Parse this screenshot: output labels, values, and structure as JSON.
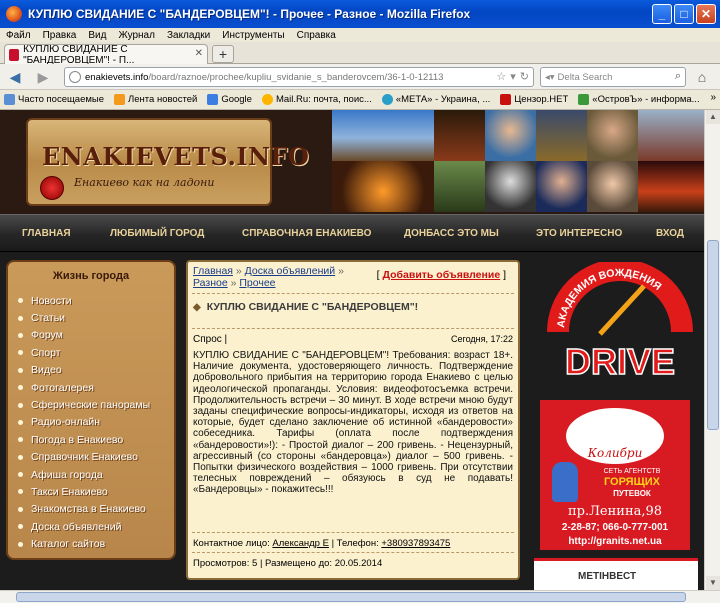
{
  "window": {
    "title": "КУПЛЮ СВИДАНИЕ С \"БАНДЕРОВЦЕМ\"! - Прочее - Разное - Mozilla Firefox"
  },
  "menubar": {
    "items": [
      "Файл",
      "Правка",
      "Вид",
      "Журнал",
      "Закладки",
      "Инструменты",
      "Справка"
    ]
  },
  "tab": {
    "label": "КУПЛЮ СВИДАНИЕ С \"БАНДЕРОВЦЕМ\"! - П..."
  },
  "navbar": {
    "url_domain": "enakievets.info",
    "url_path": "/board/raznoe/prochee/kupliu_svidanie_s_banderovcem/36-1-0-12113",
    "search_placeholder": "Delta Search"
  },
  "bookmarks": [
    "Часто посещаемые",
    "Лента новостей",
    "Google",
    "Mail.Ru: почта, поис...",
    "«МЕТА» - Украина, ...",
    "Цензор.НЕТ",
    "«ОстровЪ» - информа..."
  ],
  "bookmarks_more": "»",
  "site": {
    "logo_title": "ENAKIEVETS.INFO",
    "logo_subtitle": "Енакиево как на ладони",
    "nav": [
      "ГЛАВНАЯ",
      "ЛЮБИМЫЙ ГОРОД",
      "СПРАВОЧНАЯ ЕНАКИЕВО",
      "ДОНБАСС ЭТО МЫ",
      "ЭТО ИНТЕРЕСНО",
      "ВХОД"
    ]
  },
  "sidebar": {
    "title": "Жизнь города",
    "items": [
      "Новости",
      "Статьи",
      "Форум",
      "Спорт",
      "Видео",
      "Фотогалерея",
      "Сферические панорамы",
      "Радио-онлайн",
      "Погода в Енакиево",
      "Справочник Енакиево",
      "Афиша города",
      "Такси Енакиево",
      "Знакомства в Енакиево",
      "Доска объявлений",
      "Каталог сайтов"
    ]
  },
  "content": {
    "crumb_home": "Главная",
    "crumb_board": "Доска объявлений",
    "crumb_misc": "Разное",
    "crumb_other": "Прочее",
    "sep": "»",
    "add_bracket_open": "[",
    "add_label": "Добавить объявление",
    "add_bracket_close": "]",
    "title": "КУПЛЮ СВИДАНИЕ С \"БАНДЕРОВЦЕМ\"!",
    "type": "Спрос |",
    "date": "Сегодня, 17:22",
    "body": "КУПЛЮ СВИДАНИЕ С \"БАНДЕРОВЦЕМ\"! Требования: возраст 18+. Наличие документа, удостоверяющего личность. Подтверждение добровольного прибытия на территорию города Енакиево с целью идеологической пропаганды. Условия: видеофотосъемка встречи. Продолжительность встречи – 30 минут. В ходе встречи мною будут заданы специфические вопросы-индикаторы, исходя из ответов на которые, будет сделано заключение об истинной «бандеровости» собеседника. Тарифы (оплата после подтверждения «бандеровости»!): - Простой диалог – 200 гривень. - Нецензурный, агрессивный (со стороны «бандеровца») диалог – 500 гривень. - Попытки физического воздействия – 1000 гривень. При отсутствии телесных повреждений – обязуюсь в суд не подавать! «Бандеровцы» - покажитесь!!!",
    "contact_label": "Контактное лицо:",
    "contact_name": "Александр Е",
    "phone_label": "| Телефон:",
    "phone": "+380937893475",
    "views_label": "Просмотров:",
    "views": "5",
    "placed_label": "| Размещено до:",
    "placed_until": "20.05.2014"
  },
  "ads": {
    "drive_arc": "АКАДЕМИЯ ВОЖДЕНИЯ",
    "drive_word": "DRIVE",
    "koly_brand": "Колибри",
    "koly_agency": "СЕТЬ АГЕНТСТВ",
    "koly_hot": "ГОРЯЩИХ",
    "koly_tours": "ПУТЕВОК",
    "koly_addr": "пр.Ленина,98",
    "koly_phones": "2-28-87; 066-0-777-001",
    "koly_url": "http://granits.net.ua",
    "metinvest": "МЕТІНВЕСТ"
  },
  "colors": {
    "titlebar": "#0a5bdc",
    "nav_text": "#e9d29a",
    "content_bg": "#fbf1cf",
    "link": "#1a3c8a",
    "add_link": "#c81010"
  }
}
